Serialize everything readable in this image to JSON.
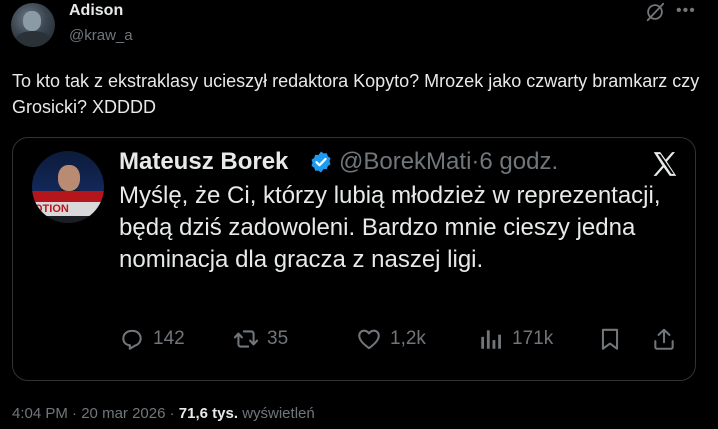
{
  "tweet": {
    "author_name": "Adison",
    "author_handle": "@kraw_a",
    "text": "To kto tak z ekstraklasy ucieszył redaktora Kopyto? Mrozek jako czwarty bramkarz czy Grosicki? XDDDD",
    "more_icon": "more-icon",
    "grok_icon": "grok-icon"
  },
  "quote": {
    "author_name": "Mateusz Borek",
    "author_handle": "@BorekMati",
    "separator": "·",
    "time": "6 godz.",
    "text": "Myślę, że Ci, którzy lubią młodzież w reprezentacji, będą dziś zadowoleni. Bardzo mnie cieszy jedna nominacja dla gracza z naszej ligi.",
    "avatar_banner": "OTION",
    "verified_color": "#1d9bf0",
    "actions": {
      "replies": "142",
      "reposts": "35",
      "likes": "1,2k",
      "views": "171k"
    }
  },
  "footer": {
    "time": "4:04 PM",
    "sep1": "·",
    "date": "20 mar 2026",
    "sep2": "·",
    "views_count": "71,6 tys.",
    "views_label": "wyświetleń"
  }
}
